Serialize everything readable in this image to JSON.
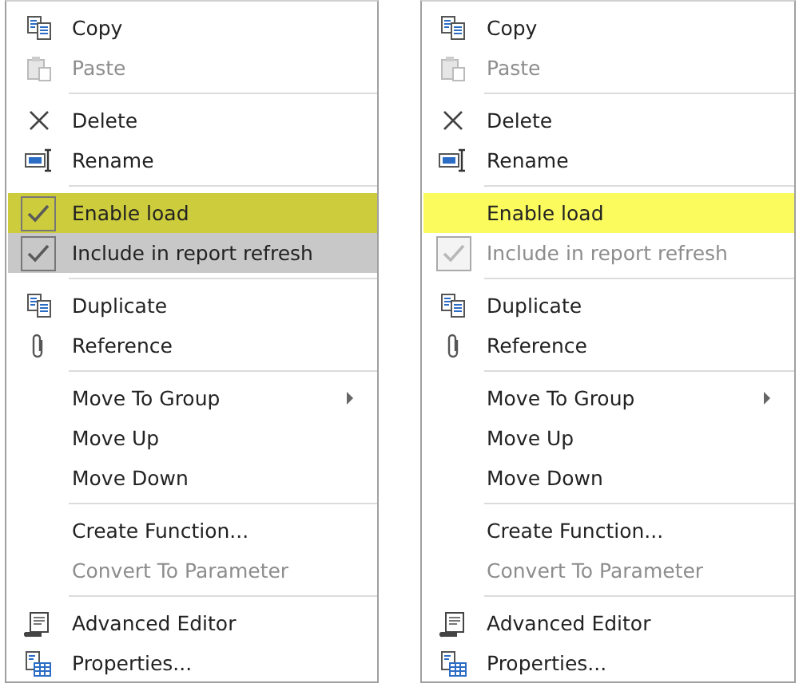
{
  "menus": [
    {
      "items": [
        {
          "kind": "command",
          "label": "Copy",
          "disabled": false
        },
        {
          "kind": "command",
          "label": "Paste",
          "disabled": true
        },
        {
          "kind": "separator"
        },
        {
          "kind": "command",
          "label": "Delete",
          "disabled": false
        },
        {
          "kind": "command",
          "label": "Rename",
          "disabled": false
        },
        {
          "kind": "separator"
        },
        {
          "kind": "checkbox",
          "label": "Enable load",
          "disabled": false,
          "checked": true,
          "color": "#cccc3c"
        },
        {
          "kind": "checkbox",
          "label": "Include in report refresh",
          "disabled": false,
          "checked": true,
          "color": "#c8c8c8"
        },
        {
          "kind": "separator"
        },
        {
          "kind": "command",
          "label": "Duplicate",
          "disabled": false
        },
        {
          "kind": "command",
          "label": "Reference",
          "disabled": false
        },
        {
          "kind": "separator"
        },
        {
          "kind": "submenu",
          "label": "Move To Group",
          "disabled": false
        },
        {
          "kind": "command",
          "label": "Move Up",
          "disabled": false
        },
        {
          "kind": "command",
          "label": "Move Down",
          "disabled": false
        },
        {
          "kind": "separator"
        },
        {
          "kind": "command",
          "label": "Create Function...",
          "disabled": false
        },
        {
          "kind": "command",
          "label": "Convert To Parameter",
          "disabled": true
        },
        {
          "kind": "separator"
        },
        {
          "kind": "command",
          "label": "Advanced Editor",
          "disabled": false
        },
        {
          "kind": "command",
          "label": "Properties...",
          "disabled": false
        }
      ]
    },
    {
      "items": [
        {
          "kind": "command",
          "label": "Copy",
          "disabled": false
        },
        {
          "kind": "command",
          "label": "Paste",
          "disabled": true
        },
        {
          "kind": "separator"
        },
        {
          "kind": "command",
          "label": "Delete",
          "disabled": false
        },
        {
          "kind": "command",
          "label": "Rename",
          "disabled": false
        },
        {
          "kind": "separator"
        },
        {
          "kind": "checkbox",
          "label": "Enable load",
          "disabled": false,
          "checked": false,
          "color": "#fbfb5e"
        },
        {
          "kind": "checkbox",
          "label": "Include in report refresh",
          "disabled": true,
          "checked": true
        },
        {
          "kind": "separator"
        },
        {
          "kind": "command",
          "label": "Duplicate",
          "disabled": false
        },
        {
          "kind": "command",
          "label": "Reference",
          "disabled": false
        },
        {
          "kind": "separator"
        },
        {
          "kind": "submenu",
          "label": "Move To Group",
          "disabled": false
        },
        {
          "kind": "command",
          "label": "Move Up",
          "disabled": false
        },
        {
          "kind": "command",
          "label": "Move Down",
          "disabled": false
        },
        {
          "kind": "separator"
        },
        {
          "kind": "command",
          "label": "Create Function...",
          "disabled": false
        },
        {
          "kind": "command",
          "label": "Convert To Parameter",
          "disabled": true
        },
        {
          "kind": "separator"
        },
        {
          "kind": "command",
          "label": "Advanced Editor",
          "disabled": false
        },
        {
          "kind": "command",
          "label": "Properties...",
          "disabled": false
        }
      ]
    }
  ]
}
